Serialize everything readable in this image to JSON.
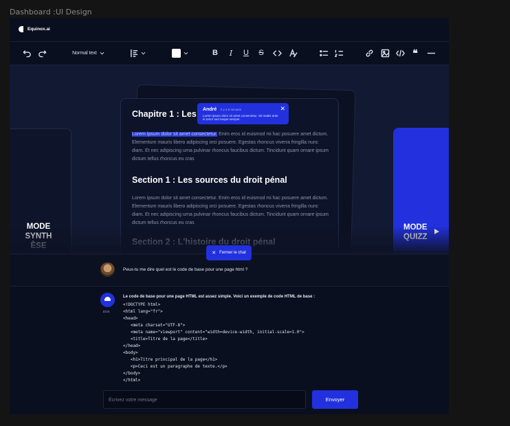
{
  "frame_title": "Dashboard :UI Design",
  "app": {
    "logo_text": "Equinox.ai"
  },
  "toolbar": {
    "text_style": "Normal text",
    "icons": [
      "undo-icon",
      "redo-icon",
      "chevron-down-icon",
      "align-icon",
      "color-icon",
      "bold-icon",
      "italic-icon",
      "underline-icon",
      "strikethrough-icon",
      "code-icon",
      "clear-format-icon",
      "bullet-list-icon",
      "numbered-list-icon",
      "link-icon",
      "image-icon",
      "embed-icon",
      "quote-icon",
      "divider-icon"
    ]
  },
  "document": {
    "chapter_title": "Chapitre 1 : Les s",
    "paragraph1_highlight": "Lorem ipsum dolor sit amet consectetur.",
    "paragraph1_rest": " Enim eros id euismod mi hac posuere amet dictum. Elementum mauris libero adipiscing orci posuere. Egestas rhoncus viverra fringilla nunc diam. Et nec adipiscing urna pulvinar rhoncus faucibus dictum. Tincidunt quam ornare ipsum dictum tellus rhoncus eu cras",
    "section1_title": "Section 1 : Les sources du droit pénal",
    "paragraph2": "Lorem ipsum dolor sit amet consectetur. Enim eros id euismod mi hac posuere amet dictum. Elementum mauris libero adipiscing orci posuere. Egestas rhoncus viverra fringilla nunc diam. Et nec adipiscing urna pulvinar rhoncus faucibus dictum. Tincidunt quam ornare ipsum dictum tellus rhoncus eu cras",
    "section2_title": "Section 2 : L'histoire du droit pénal"
  },
  "comment": {
    "author": "André",
    "time": "Il y a 5 minutes",
    "body": "Lorem ipsum dolor sit amet consectetur. Sit mattis ante in tortor sed neque semper."
  },
  "modes": {
    "left_line1": "MODE",
    "left_line2": "SYNTH",
    "left_line3": "ÈSE",
    "right_line1": "MODE",
    "right_line2": "QUIZZ"
  },
  "chat": {
    "close_label": "Fermer le chat",
    "user_message": "Peux-tu me dire quel est le code de base pour une page html ?",
    "bot_label": "EOS",
    "bot_intro": "Le code de base pour une page HTML est assez simple. Voici un exemple de code HTML de base :",
    "bot_code": "<!DOCTYPE html>\n<html lang=\"fr\">\n<head>\n   <meta charset=\"UTF-8\">\n   <meta name=\"viewport\" content=\"width=device-width, initial-scale=1.0\">\n   <title>Titre de la page</title>\n</head>\n<body>\n   <h1>Titre principal de la page</h1>\n   <p>Ceci est un paragraphe de texte.</p>\n</body>\n</html>",
    "input_placeholder": "Écrivez votre message",
    "send_label": "Envoyer"
  }
}
